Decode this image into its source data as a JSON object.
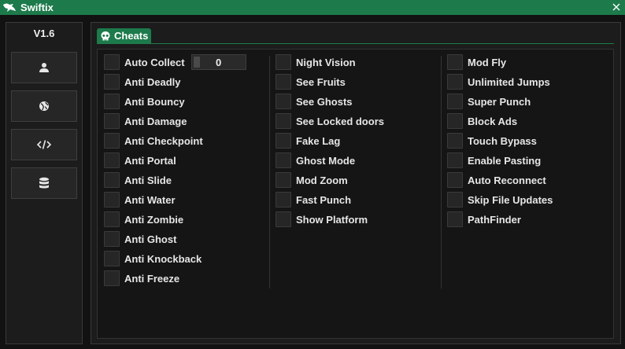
{
  "app": {
    "title": "Swiftix",
    "logo_icon": "swift-bird-logo",
    "close_icon": "close-icon"
  },
  "sidebar": {
    "version": "V1.6",
    "buttons": [
      {
        "icon": "user-icon"
      },
      {
        "icon": "globe-icon"
      },
      {
        "icon": "code-icon"
      },
      {
        "icon": "database-icon"
      }
    ]
  },
  "tabs": [
    {
      "label": "Cheats",
      "icon": "skull-icon",
      "active": true
    }
  ],
  "cheats": {
    "auto_collect_value": "0",
    "col1": [
      "Auto Collect",
      "Anti Deadly",
      "Anti Bouncy",
      "Anti Damage",
      "Anti Checkpoint",
      "Anti Portal",
      "Anti Slide",
      "Anti Water",
      "Anti Zombie",
      "Anti Ghost",
      "Anti Knockback",
      "Anti Freeze"
    ],
    "col2": [
      "Night Vision",
      "See Fruits",
      "See Ghosts",
      "See Locked doors",
      "Fake Lag",
      "Ghost Mode",
      "Mod Zoom",
      "Fast Punch",
      "Show Platform"
    ],
    "col3": [
      "Mod Fly",
      "Unlimited Jumps",
      "Super Punch",
      "Block Ads",
      "Touch Bypass",
      "Enable Pasting",
      "Auto Reconnect",
      "Skip File Updates",
      "PathFinder"
    ]
  },
  "colors": {
    "accent": "#1d7a4b",
    "background": "#121212",
    "panel": "#1c1c1c"
  }
}
